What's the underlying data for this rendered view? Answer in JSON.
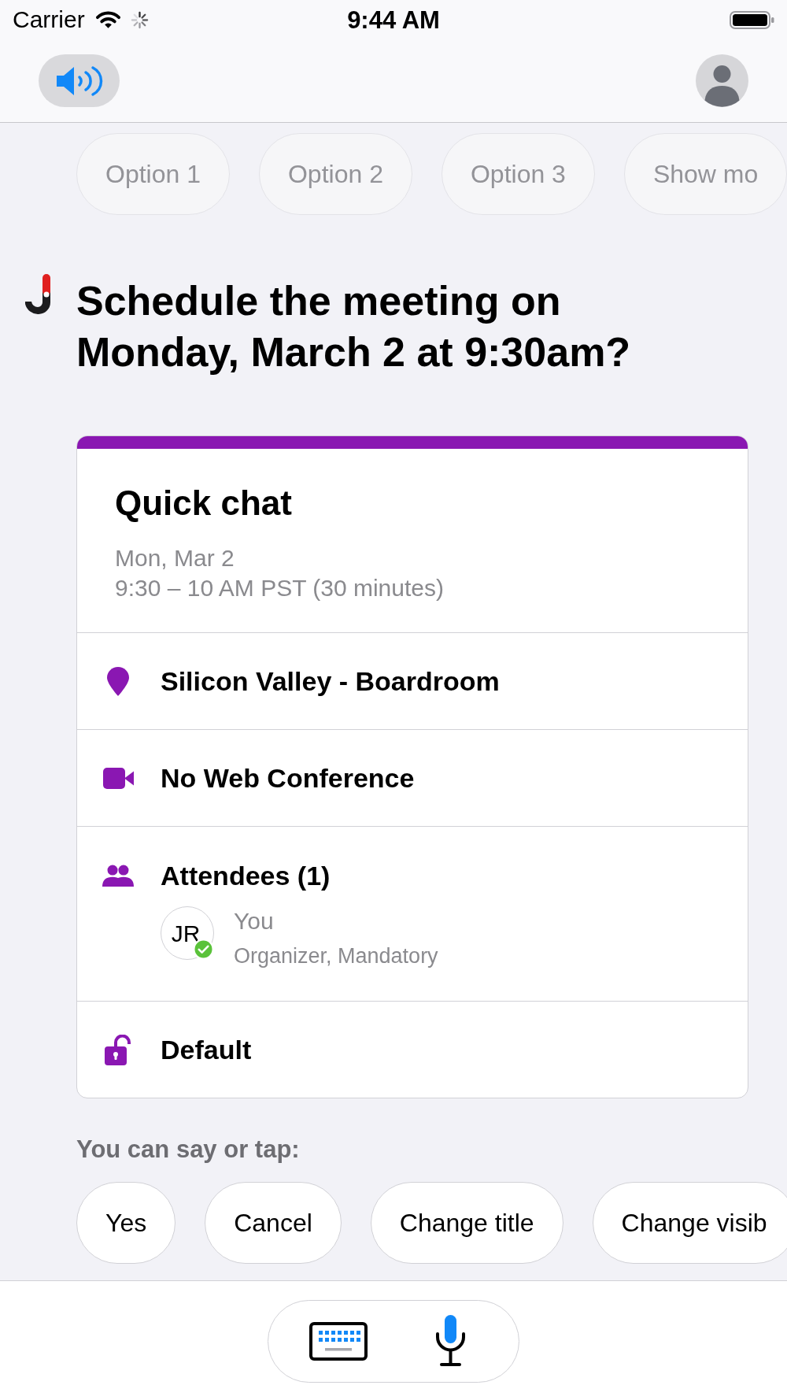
{
  "status_bar": {
    "carrier": "Carrier",
    "time": "9:44 AM"
  },
  "options": [
    {
      "label": "Option 1",
      "disabled": true
    },
    {
      "label": "Option 2",
      "disabled": true
    },
    {
      "label": "Option 3",
      "disabled": true
    },
    {
      "label": "Show mo",
      "disabled": true
    }
  ],
  "question": "Schedule the meeting on Monday, March 2 at 9:30am?",
  "event": {
    "title": "Quick chat",
    "date": "Mon, Mar 2",
    "time": "9:30 – 10 AM PST (30 minutes)",
    "rows": [
      {
        "kind": "location",
        "label": "Silicon Valley - Boardroom"
      },
      {
        "kind": "conference",
        "label": "No Web Conference"
      },
      {
        "kind": "attendees",
        "label": "Attendees (1)",
        "attendees": [
          {
            "initials": "JR",
            "name": "You",
            "role": "Organizer, Mandatory",
            "accepted": true
          }
        ]
      },
      {
        "kind": "visibility",
        "label": "Default"
      }
    ]
  },
  "prompt": "You can say or tap:",
  "suggestions": [
    {
      "label": "Yes",
      "disabled": false
    },
    {
      "label": "Cancel",
      "disabled": false
    },
    {
      "label": "Change title",
      "disabled": false
    },
    {
      "label": "Change visib",
      "disabled": false
    }
  ]
}
